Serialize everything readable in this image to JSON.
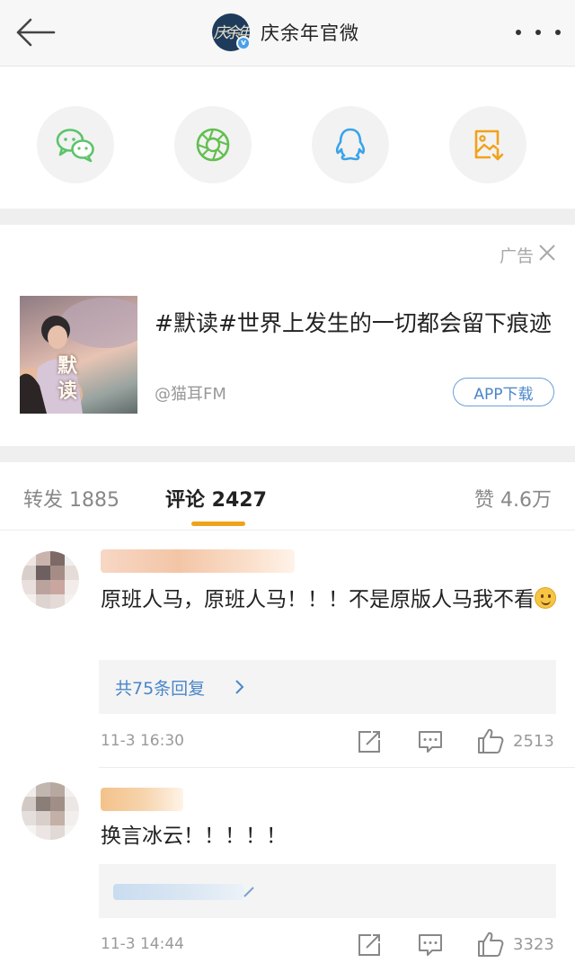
{
  "header": {
    "title": "庆余年官微",
    "avatar_text": "庆余年",
    "verified_badge": "v"
  },
  "share": {
    "items": [
      {
        "name": "wechat-icon",
        "color": "#62c86d"
      },
      {
        "name": "moments-icon",
        "color": "#6cc24a"
      },
      {
        "name": "qq-icon",
        "color": "#3aa3e8"
      },
      {
        "name": "save-image-icon",
        "color": "#f0a21b"
      }
    ]
  },
  "ad": {
    "label": "广告",
    "title": "#默读#世界上发生的一切都会留下痕迹",
    "source": "@猫耳FM",
    "button": "APP下载",
    "cover_text": "默读"
  },
  "tabs": {
    "repost": "转发 1885",
    "comments": "评论 2427",
    "likes": "赞 4.6万",
    "active_color": "#f0a21b"
  },
  "comments": [
    {
      "text_main": "原班人马，原班人马！！！不是原版人马我不看",
      "reply_summary": "共75条回复",
      "time": "11-3 16:30",
      "likes": "2513"
    },
    {
      "text_main": "换言冰云！！！！！",
      "time": "11-3 14:44",
      "likes": "3323"
    }
  ],
  "colors": {
    "link": "#4a86c9",
    "accent": "#f0a21b"
  }
}
